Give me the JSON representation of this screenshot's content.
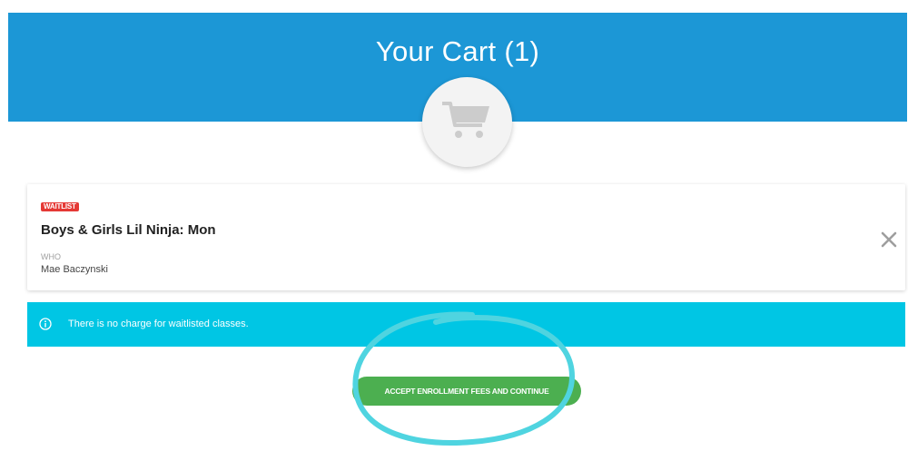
{
  "header": {
    "title": "Your Cart (1)"
  },
  "cart_icon": {
    "name": "cart-icon"
  },
  "cart_item": {
    "badge": "WAITLIST",
    "class_name": "Boys & Girls Lil Ninja: Mon",
    "who_label": "WHO",
    "who_value": "Mae Baczynski",
    "remove_icon": "close-icon"
  },
  "info_bar": {
    "icon": "info-icon",
    "message": "There is no charge for waitlisted classes."
  },
  "actions": {
    "accept_label": "ACCEPT ENROLLMENT FEES AND CONTINUE"
  },
  "colors": {
    "header": "#1c97d6",
    "badge": "#e53935",
    "info_bar": "#00c6e4",
    "accept_button": "#4caf50",
    "annotation": "#4fd4e0"
  }
}
